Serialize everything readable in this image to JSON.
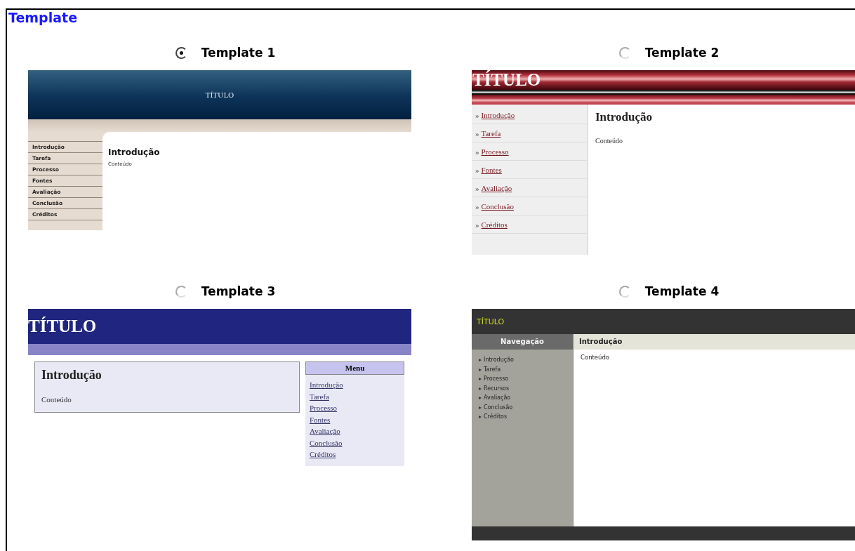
{
  "title": "Template",
  "templates": [
    {
      "label": "Template 1",
      "selected": true,
      "preview": {
        "kind": "t1",
        "title": "TÍTULO",
        "heading": "Introdução",
        "content": "Conteúdo",
        "nav": [
          "Introdução",
          "Tarefa",
          "Processo",
          "Fontes",
          "Avaliação",
          "Conclusão",
          "Créditos"
        ]
      }
    },
    {
      "label": "Template 2",
      "selected": false,
      "preview": {
        "kind": "t2",
        "title": "TÍTULO",
        "heading": "Introdução",
        "content": "Conteúdo",
        "bullet": "»",
        "nav": [
          "Introdução",
          "Tarefa",
          "Processo",
          "Fontes",
          "Avaliação",
          "Conclusão",
          "Créditos"
        ]
      }
    },
    {
      "label": "Template 3",
      "selected": false,
      "preview": {
        "kind": "t3",
        "title": "TÍTULO",
        "heading": "Introdução",
        "content": "Conteúdo",
        "menu_title": "Menu",
        "nav": [
          "Introdução",
          "Tarefa",
          "Processo",
          "Fontes",
          "Avaliação",
          "Conclusão",
          "Créditos"
        ]
      }
    },
    {
      "label": "Template 4",
      "selected": false,
      "preview": {
        "kind": "t4",
        "title": "TÍTULO",
        "heading": "Introdução",
        "content": "Conteúdo",
        "menu_title": "Navegação",
        "bullet": "▸",
        "nav": [
          "Introdução",
          "Tarefa",
          "Processo",
          "Recursos",
          "Avaliação",
          "Conclusão",
          "Créditos"
        ]
      }
    }
  ]
}
